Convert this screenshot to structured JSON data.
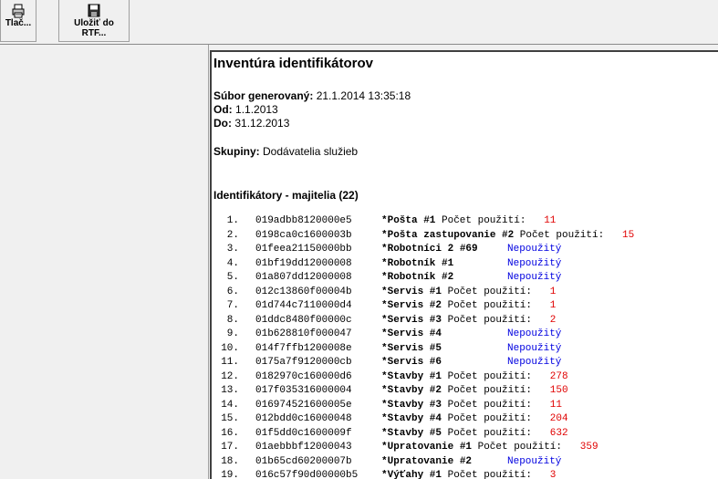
{
  "toolbar": {
    "print_label": "Tlač...",
    "save_label_1": "Uložiť do",
    "save_label_2": "RTF..."
  },
  "report": {
    "title": "Inventúra identifikátorov",
    "generated_label": "Súbor generovaný:",
    "generated_value": "21.1.2014 13:35:18",
    "from_label": "Od:",
    "from_value": "1.1.2013",
    "to_label": "Do:",
    "to_value": "31.12.2013",
    "groups_label": "Skupiny:",
    "groups_value": "Dodávatelia služieb",
    "section_title": "Identifikátory - majitelia (22)",
    "usage_label": "Počet použití:",
    "unused_label": "Nepoužitý",
    "rows": [
      {
        "n": "1.",
        "id": "019adbb8120000e5",
        "name": "*Pošta #1",
        "count": "11"
      },
      {
        "n": "2.",
        "id": "0198ca0c1600003b",
        "name": "*Pošta zastupovanie #2",
        "count": "15"
      },
      {
        "n": "3.",
        "id": "01feea21150000bb",
        "name": "*Robotníci 2 #69",
        "count": ""
      },
      {
        "n": "4.",
        "id": "01bf19dd12000008",
        "name": "*Robotník #1",
        "count": ""
      },
      {
        "n": "5.",
        "id": "01a807dd12000008",
        "name": "*Robotník #2",
        "count": ""
      },
      {
        "n": "6.",
        "id": "012c13860f00004b",
        "name": "*Servis #1",
        "count": "1"
      },
      {
        "n": "7.",
        "id": "01d744c7110000d4",
        "name": "*Servis #2",
        "count": "1"
      },
      {
        "n": "8.",
        "id": "01ddc8480f00000c",
        "name": "*Servis #3",
        "count": "2"
      },
      {
        "n": "9.",
        "id": "01b628810f000047",
        "name": "*Servis #4",
        "count": ""
      },
      {
        "n": "10.",
        "id": "014f7ffb1200008e",
        "name": "*Servis #5",
        "count": ""
      },
      {
        "n": "11.",
        "id": "0175a7f9120000cb",
        "name": "*Servis #6",
        "count": ""
      },
      {
        "n": "12.",
        "id": "0182970c160000d6",
        "name": "*Stavby #1",
        "count": "278"
      },
      {
        "n": "13.",
        "id": "017f035316000004",
        "name": "*Stavby #2",
        "count": "150"
      },
      {
        "n": "14.",
        "id": "016974521600005e",
        "name": "*Stavby #3",
        "count": "11"
      },
      {
        "n": "15.",
        "id": "012bdd0c16000048",
        "name": "*Stavby #4",
        "count": "204"
      },
      {
        "n": "16.",
        "id": "01f5dd0c1600009f",
        "name": "*Stavby #5",
        "count": "632"
      },
      {
        "n": "17.",
        "id": "01aebbbf12000043",
        "name": "*Upratovanie #1",
        "count": "359"
      },
      {
        "n": "18.",
        "id": "01b65cd60200007b",
        "name": "*Upratovanie #2",
        "count": ""
      },
      {
        "n": "19.",
        "id": "016c57f90d00000b5",
        "name": "*Výťahy #1",
        "count": "3"
      }
    ]
  }
}
